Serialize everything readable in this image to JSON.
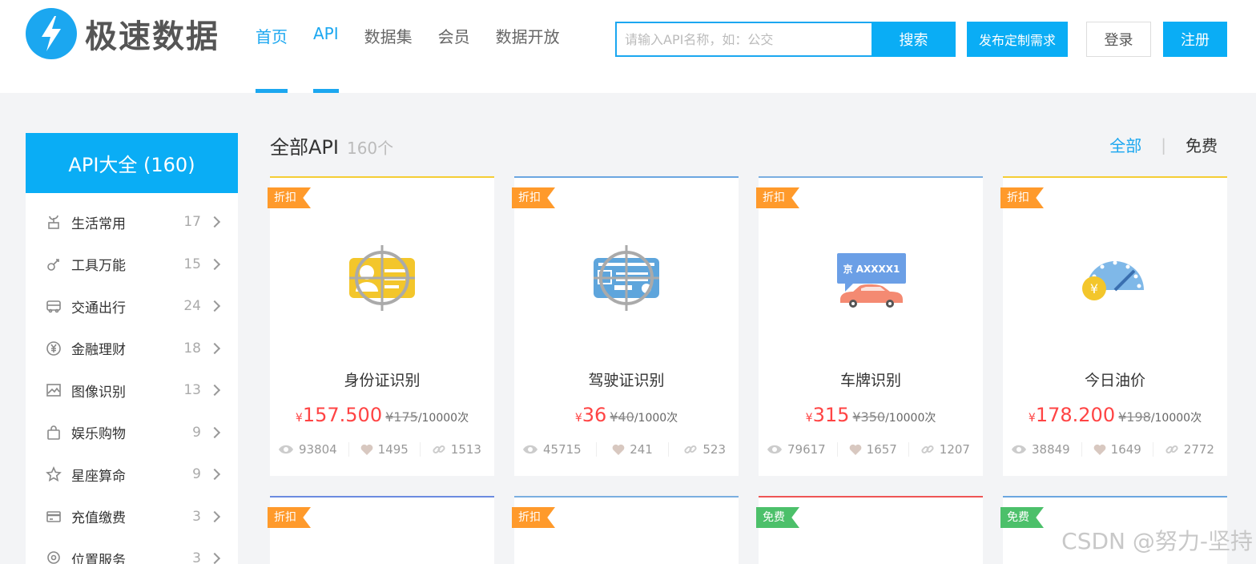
{
  "header": {
    "logo_text": "极速数据",
    "nav": [
      {
        "label": "首页",
        "active": true
      },
      {
        "label": "API",
        "active": true
      },
      {
        "label": "数据集",
        "active": false
      },
      {
        "label": "会员",
        "active": false
      },
      {
        "label": "数据开放",
        "active": false
      }
    ],
    "search": {
      "placeholder": "请输入API名称，如：公交",
      "button": "搜索"
    },
    "publish_button": "发布定制需求",
    "login_button": "登录",
    "register_button": "注册"
  },
  "sidebar": {
    "title": "API大全 (160)",
    "items": [
      {
        "label": "生活常用",
        "count": "17",
        "icon": "plant-icon"
      },
      {
        "label": "工具万能",
        "count": "15",
        "icon": "wrench-icon"
      },
      {
        "label": "交通出行",
        "count": "24",
        "icon": "bus-icon"
      },
      {
        "label": "金融理财",
        "count": "18",
        "icon": "yen-coin-icon"
      },
      {
        "label": "图像识别",
        "count": "13",
        "icon": "image-icon"
      },
      {
        "label": "娱乐购物",
        "count": "9",
        "icon": "shopping-bag-icon"
      },
      {
        "label": "星座算命",
        "count": "9",
        "icon": "star-icon"
      },
      {
        "label": "充值缴费",
        "count": "3",
        "icon": "card-icon"
      },
      {
        "label": "位置服务",
        "count": "3",
        "icon": "location-icon"
      }
    ]
  },
  "main": {
    "title": "全部API",
    "count": "160个",
    "filter": {
      "all": "全部",
      "sep": "|",
      "free": "免费"
    }
  },
  "cards": [
    {
      "tag": "折扣",
      "tag_type": "discount",
      "name": "身份证识别",
      "icon": "id-card-scan-icon",
      "yen": "¥",
      "price": "157.500",
      "old_price": "¥175",
      "unit": "/10000次",
      "views": "93804",
      "likes": "1495",
      "links": "1513"
    },
    {
      "tag": "折扣",
      "tag_type": "discount",
      "name": "驾驶证识别",
      "icon": "license-scan-icon",
      "yen": "¥",
      "price": "36",
      "old_price": "¥40",
      "unit": "/1000次",
      "views": "45715",
      "likes": "241",
      "links": "523"
    },
    {
      "tag": "折扣",
      "tag_type": "discount",
      "name": "车牌识别",
      "icon": "car-plate-icon",
      "yen": "¥",
      "price": "315",
      "old_price": "¥350",
      "unit": "/10000次",
      "views": "79617",
      "likes": "1657",
      "links": "1207",
      "plate": "京 AXXXX1"
    },
    {
      "tag": "折扣",
      "tag_type": "discount",
      "name": "今日油价",
      "icon": "fuel-gauge-icon",
      "yen": "¥",
      "price": "178.200",
      "old_price": "¥198",
      "unit": "/10000次",
      "views": "38849",
      "likes": "1649",
      "links": "2772",
      "coin": "¥"
    }
  ],
  "row2_tags": [
    {
      "tag": "折扣",
      "tag_type": "discount"
    },
    {
      "tag": "折扣",
      "tag_type": "discount"
    },
    {
      "tag": "免费",
      "tag_type": "free"
    },
    {
      "tag": "免费",
      "tag_type": "free"
    }
  ],
  "watermark": "CSDN @努力-坚持",
  "colors": {
    "accent": "#1ba7f0",
    "price": "#ff4444",
    "discount_tag": "#ff9a2b",
    "free_tag": "#4cc06a"
  }
}
